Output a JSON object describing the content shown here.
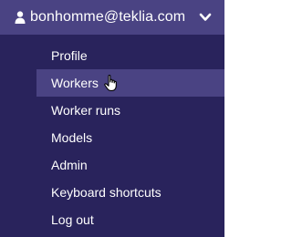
{
  "user": {
    "email": "bonhomme@teklia.com",
    "icon": "user-icon",
    "toggle_icon": "chevron-down-icon"
  },
  "menu": {
    "items": [
      {
        "label": "Profile"
      },
      {
        "label": "Workers",
        "hovered": true
      },
      {
        "label": "Worker runs"
      },
      {
        "label": "Models"
      },
      {
        "label": "Admin"
      },
      {
        "label": "Keyboard shortcuts"
      },
      {
        "label": "Log out"
      }
    ]
  },
  "colors": {
    "header_bg": "#4a4383",
    "menu_bg": "#29235c",
    "hover_bg": "#4a4383",
    "text": "#ffffff"
  }
}
